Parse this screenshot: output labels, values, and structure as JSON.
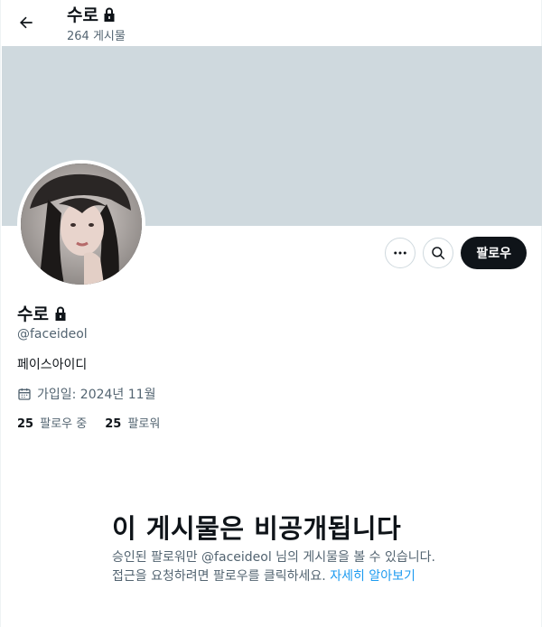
{
  "header": {
    "title": "수로",
    "post_count": "264 게시물"
  },
  "profile": {
    "name": "수로",
    "handle": "@faceideol",
    "bio": "페이스아이디",
    "joined": "가입일: 2024년 11월",
    "following_count": "25",
    "following_label": "팔로우 중",
    "followers_count": "25",
    "followers_label": "팔로워"
  },
  "actions": {
    "follow_label": "팔로우"
  },
  "private_notice": {
    "title": "이 게시물은 비공개됩니다",
    "description": "승인된 팔로워만 @faceideol 님의 게시물을 볼 수 있습니다. 접근을 요청하려면 팔로우를 클릭하세요. ",
    "link": "자세히 알아보기"
  },
  "icons": {
    "back": "arrow-left-icon",
    "lock": "lock-icon",
    "more": "more-icon",
    "search": "search-icon",
    "calendar": "calendar-icon"
  },
  "colors": {
    "banner": "#cfd9de",
    "follow_button": "#0f1419",
    "link": "#1d9bf0",
    "secondary_text": "#536471"
  }
}
